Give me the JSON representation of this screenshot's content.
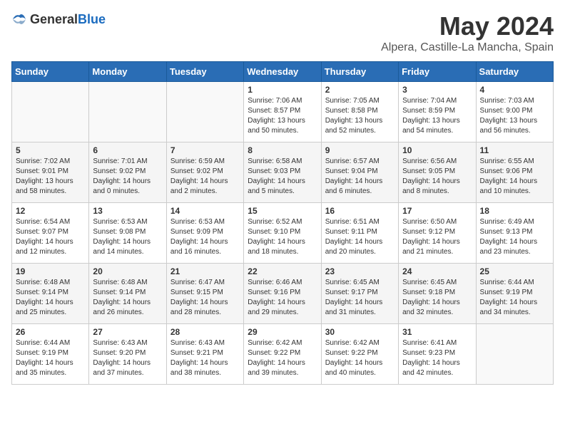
{
  "logo": {
    "general": "General",
    "blue": "Blue"
  },
  "title": "May 2024",
  "subtitle": "Alpera, Castille-La Mancha, Spain",
  "weekdays": [
    "Sunday",
    "Monday",
    "Tuesday",
    "Wednesday",
    "Thursday",
    "Friday",
    "Saturday"
  ],
  "weeks": [
    [
      {
        "day": "",
        "info": ""
      },
      {
        "day": "",
        "info": ""
      },
      {
        "day": "",
        "info": ""
      },
      {
        "day": "1",
        "info": "Sunrise: 7:06 AM\nSunset: 8:57 PM\nDaylight: 13 hours\nand 50 minutes."
      },
      {
        "day": "2",
        "info": "Sunrise: 7:05 AM\nSunset: 8:58 PM\nDaylight: 13 hours\nand 52 minutes."
      },
      {
        "day": "3",
        "info": "Sunrise: 7:04 AM\nSunset: 8:59 PM\nDaylight: 13 hours\nand 54 minutes."
      },
      {
        "day": "4",
        "info": "Sunrise: 7:03 AM\nSunset: 9:00 PM\nDaylight: 13 hours\nand 56 minutes."
      }
    ],
    [
      {
        "day": "5",
        "info": "Sunrise: 7:02 AM\nSunset: 9:01 PM\nDaylight: 13 hours\nand 58 minutes."
      },
      {
        "day": "6",
        "info": "Sunrise: 7:01 AM\nSunset: 9:02 PM\nDaylight: 14 hours\nand 0 minutes."
      },
      {
        "day": "7",
        "info": "Sunrise: 6:59 AM\nSunset: 9:02 PM\nDaylight: 14 hours\nand 2 minutes."
      },
      {
        "day": "8",
        "info": "Sunrise: 6:58 AM\nSunset: 9:03 PM\nDaylight: 14 hours\nand 5 minutes."
      },
      {
        "day": "9",
        "info": "Sunrise: 6:57 AM\nSunset: 9:04 PM\nDaylight: 14 hours\nand 6 minutes."
      },
      {
        "day": "10",
        "info": "Sunrise: 6:56 AM\nSunset: 9:05 PM\nDaylight: 14 hours\nand 8 minutes."
      },
      {
        "day": "11",
        "info": "Sunrise: 6:55 AM\nSunset: 9:06 PM\nDaylight: 14 hours\nand 10 minutes."
      }
    ],
    [
      {
        "day": "12",
        "info": "Sunrise: 6:54 AM\nSunset: 9:07 PM\nDaylight: 14 hours\nand 12 minutes."
      },
      {
        "day": "13",
        "info": "Sunrise: 6:53 AM\nSunset: 9:08 PM\nDaylight: 14 hours\nand 14 minutes."
      },
      {
        "day": "14",
        "info": "Sunrise: 6:53 AM\nSunset: 9:09 PM\nDaylight: 14 hours\nand 16 minutes."
      },
      {
        "day": "15",
        "info": "Sunrise: 6:52 AM\nSunset: 9:10 PM\nDaylight: 14 hours\nand 18 minutes."
      },
      {
        "day": "16",
        "info": "Sunrise: 6:51 AM\nSunset: 9:11 PM\nDaylight: 14 hours\nand 20 minutes."
      },
      {
        "day": "17",
        "info": "Sunrise: 6:50 AM\nSunset: 9:12 PM\nDaylight: 14 hours\nand 21 minutes."
      },
      {
        "day": "18",
        "info": "Sunrise: 6:49 AM\nSunset: 9:13 PM\nDaylight: 14 hours\nand 23 minutes."
      }
    ],
    [
      {
        "day": "19",
        "info": "Sunrise: 6:48 AM\nSunset: 9:14 PM\nDaylight: 14 hours\nand 25 minutes."
      },
      {
        "day": "20",
        "info": "Sunrise: 6:48 AM\nSunset: 9:14 PM\nDaylight: 14 hours\nand 26 minutes."
      },
      {
        "day": "21",
        "info": "Sunrise: 6:47 AM\nSunset: 9:15 PM\nDaylight: 14 hours\nand 28 minutes."
      },
      {
        "day": "22",
        "info": "Sunrise: 6:46 AM\nSunset: 9:16 PM\nDaylight: 14 hours\nand 29 minutes."
      },
      {
        "day": "23",
        "info": "Sunrise: 6:45 AM\nSunset: 9:17 PM\nDaylight: 14 hours\nand 31 minutes."
      },
      {
        "day": "24",
        "info": "Sunrise: 6:45 AM\nSunset: 9:18 PM\nDaylight: 14 hours\nand 32 minutes."
      },
      {
        "day": "25",
        "info": "Sunrise: 6:44 AM\nSunset: 9:19 PM\nDaylight: 14 hours\nand 34 minutes."
      }
    ],
    [
      {
        "day": "26",
        "info": "Sunrise: 6:44 AM\nSunset: 9:19 PM\nDaylight: 14 hours\nand 35 minutes."
      },
      {
        "day": "27",
        "info": "Sunrise: 6:43 AM\nSunset: 9:20 PM\nDaylight: 14 hours\nand 37 minutes."
      },
      {
        "day": "28",
        "info": "Sunrise: 6:43 AM\nSunset: 9:21 PM\nDaylight: 14 hours\nand 38 minutes."
      },
      {
        "day": "29",
        "info": "Sunrise: 6:42 AM\nSunset: 9:22 PM\nDaylight: 14 hours\nand 39 minutes."
      },
      {
        "day": "30",
        "info": "Sunrise: 6:42 AM\nSunset: 9:22 PM\nDaylight: 14 hours\nand 40 minutes."
      },
      {
        "day": "31",
        "info": "Sunrise: 6:41 AM\nSunset: 9:23 PM\nDaylight: 14 hours\nand 42 minutes."
      },
      {
        "day": "",
        "info": ""
      }
    ]
  ]
}
